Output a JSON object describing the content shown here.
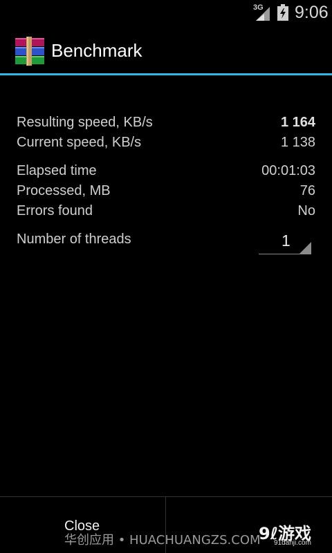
{
  "status_bar": {
    "network": "3G",
    "time": "9:06",
    "signal_icon": "signal-icon",
    "battery_icon": "battery-charging-icon"
  },
  "action_bar": {
    "title": "Benchmark",
    "app_icon": "winrar-books-icon",
    "accent_color": "#33b5e5"
  },
  "stats": {
    "resulting_speed": {
      "label": "Resulting speed, KB/s",
      "value": "1 164"
    },
    "current_speed": {
      "label": "Current speed, KB/s",
      "value": "1 138"
    },
    "elapsed_time": {
      "label": "Elapsed time",
      "value": "00:01:03"
    },
    "processed": {
      "label": "Processed, MB",
      "value": "76"
    },
    "errors": {
      "label": "Errors found",
      "value": "No"
    },
    "threads": {
      "label": "Number of threads",
      "value": "1"
    }
  },
  "buttons": {
    "close": "Close"
  },
  "watermarks": {
    "left": "华创应用 • HUACHUANGZS.COM",
    "right_logo": "9ℓ游戏",
    "right_domain": "91danji.com"
  }
}
